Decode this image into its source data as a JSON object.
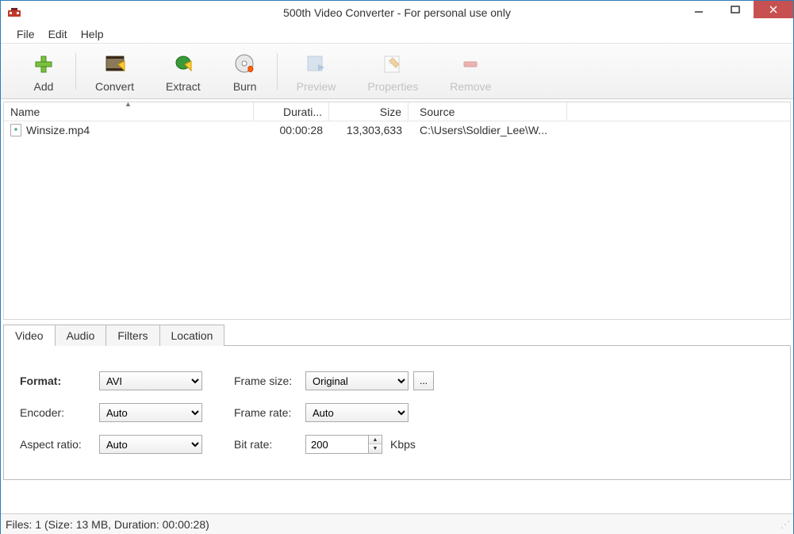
{
  "window": {
    "title": "500th Video Converter - For personal use only"
  },
  "menu": {
    "file": "File",
    "edit": "Edit",
    "help": "Help"
  },
  "toolbar": {
    "add": "Add",
    "convert": "Convert",
    "extract": "Extract",
    "burn": "Burn",
    "preview": "Preview",
    "properties": "Properties",
    "remove": "Remove"
  },
  "columns": {
    "name": "Name",
    "duration": "Durati...",
    "size": "Size",
    "source": "Source"
  },
  "files": [
    {
      "name": "Winsize.mp4",
      "duration": "00:00:28",
      "size": "13,303,633",
      "source": "C:\\Users\\Soldier_Lee\\W..."
    }
  ],
  "tabs": {
    "video": "Video",
    "audio": "Audio",
    "filters": "Filters",
    "location": "Location"
  },
  "video_form": {
    "format_label": "Format:",
    "format_value": "AVI",
    "encoder_label": "Encoder:",
    "encoder_value": "Auto",
    "aspect_label": "Aspect ratio:",
    "aspect_value": "Auto",
    "framesize_label": "Frame size:",
    "framesize_value": "Original",
    "framerate_label": "Frame rate:",
    "framerate_value": "Auto",
    "bitrate_label": "Bit rate:",
    "bitrate_value": "200",
    "bitrate_unit": "Kbps",
    "ellipsis": "..."
  },
  "status": {
    "text": "Files: 1 (Size: 13 MB, Duration: 00:00:28)"
  }
}
